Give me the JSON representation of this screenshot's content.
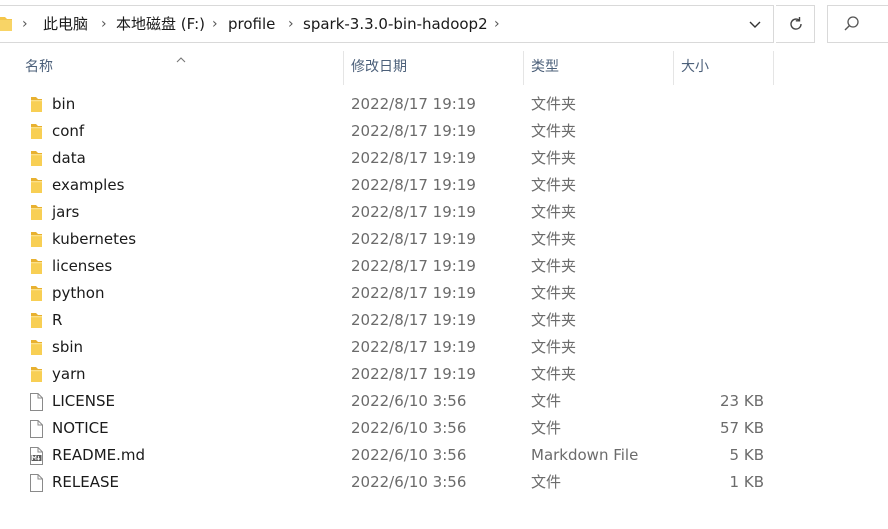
{
  "address_bar": {
    "breadcrumbs": [
      "此电脑",
      "本地磁盘 (F:)",
      "profile",
      "spark-3.3.0-bin-hadoop2"
    ]
  },
  "columns": {
    "name": "名称",
    "modified": "修改日期",
    "type": "类型",
    "size": "大小"
  },
  "files": [
    {
      "name": "bin",
      "modified": "2022/8/17 19:19",
      "type": "文件夹",
      "size": "",
      "icon": "folder-icon"
    },
    {
      "name": "conf",
      "modified": "2022/8/17 19:19",
      "type": "文件夹",
      "size": "",
      "icon": "folder-icon"
    },
    {
      "name": "data",
      "modified": "2022/8/17 19:19",
      "type": "文件夹",
      "size": "",
      "icon": "folder-icon"
    },
    {
      "name": "examples",
      "modified": "2022/8/17 19:19",
      "type": "文件夹",
      "size": "",
      "icon": "folder-icon"
    },
    {
      "name": "jars",
      "modified": "2022/8/17 19:19",
      "type": "文件夹",
      "size": "",
      "icon": "folder-icon"
    },
    {
      "name": "kubernetes",
      "modified": "2022/8/17 19:19",
      "type": "文件夹",
      "size": "",
      "icon": "folder-icon"
    },
    {
      "name": "licenses",
      "modified": "2022/8/17 19:19",
      "type": "文件夹",
      "size": "",
      "icon": "folder-icon"
    },
    {
      "name": "python",
      "modified": "2022/8/17 19:19",
      "type": "文件夹",
      "size": "",
      "icon": "folder-icon"
    },
    {
      "name": "R",
      "modified": "2022/8/17 19:19",
      "type": "文件夹",
      "size": "",
      "icon": "folder-icon"
    },
    {
      "name": "sbin",
      "modified": "2022/8/17 19:19",
      "type": "文件夹",
      "size": "",
      "icon": "folder-icon"
    },
    {
      "name": "yarn",
      "modified": "2022/8/17 19:19",
      "type": "文件夹",
      "size": "",
      "icon": "folder-icon"
    },
    {
      "name": "LICENSE",
      "modified": "2022/6/10 3:56",
      "type": "文件",
      "size": "23 KB",
      "icon": "file-icon"
    },
    {
      "name": "NOTICE",
      "modified": "2022/6/10 3:56",
      "type": "文件",
      "size": "57 KB",
      "icon": "file-icon"
    },
    {
      "name": "README.md",
      "modified": "2022/6/10 3:56",
      "type": "Markdown File",
      "size": "5 KB",
      "icon": "markdown-file-icon"
    },
    {
      "name": "RELEASE",
      "modified": "2022/6/10 3:56",
      "type": "文件",
      "size": "1 KB",
      "icon": "file-icon"
    }
  ],
  "colors": {
    "folder": "#f4c64a",
    "header_text": "#4c607a",
    "border": "#d9d9d9"
  }
}
